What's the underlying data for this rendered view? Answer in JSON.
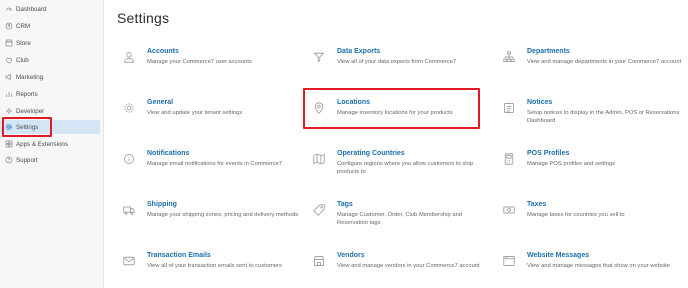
{
  "sidebar": {
    "items": [
      {
        "label": "Dashboard",
        "icon": "dashboard-icon"
      },
      {
        "label": "CRM",
        "icon": "crm-icon"
      },
      {
        "label": "Store",
        "icon": "store-icon"
      },
      {
        "label": "Club",
        "icon": "club-icon"
      },
      {
        "label": "Marketing",
        "icon": "marketing-icon"
      },
      {
        "label": "Reports",
        "icon": "reports-icon"
      },
      {
        "label": "Developer",
        "icon": "developer-icon"
      },
      {
        "label": "Settings",
        "icon": "settings-icon",
        "active": true
      },
      {
        "label": "Apps & Extensions",
        "icon": "apps-icon"
      },
      {
        "label": "Support",
        "icon": "support-icon"
      }
    ]
  },
  "main": {
    "title": "Settings",
    "tiles": [
      {
        "title": "Accounts",
        "desc": "Manage your Commerce7 user accounts",
        "icon": "user-icon"
      },
      {
        "title": "Data Exports",
        "desc": "View all of your data exports from Commerce7",
        "icon": "funnel-icon"
      },
      {
        "title": "Departments",
        "desc": "View and manage departments in your Commerce7 account",
        "icon": "sitemap-icon"
      },
      {
        "title": "General",
        "desc": "View and update your tenant settings",
        "icon": "gear-icon"
      },
      {
        "title": "Locations",
        "desc": "Manage inventory locations for your products",
        "icon": "map-pin-icon"
      },
      {
        "title": "Notices",
        "desc": "Setup notices to display in the Admin, POS or Reservations Dashboard",
        "icon": "notice-icon"
      },
      {
        "title": "Notifications",
        "desc": "Manage email notifications for events in Commerce7",
        "icon": "info-icon"
      },
      {
        "title": "Operating Countries",
        "desc": "Configure regions where you allow customers to ship products to",
        "icon": "map-icon"
      },
      {
        "title": "POS Profiles",
        "desc": "Manage POS profiles and settings",
        "icon": "pos-icon"
      },
      {
        "title": "Shipping",
        "desc": "Manage your shipping zones, pricing and delivery methods",
        "icon": "truck-icon"
      },
      {
        "title": "Tags",
        "desc": "Manage Customer, Order, Club Membership and Reservation tags",
        "icon": "tag-icon"
      },
      {
        "title": "Taxes",
        "desc": "Manage taxes for countries you sell to",
        "icon": "money-icon"
      },
      {
        "title": "Transaction Emails",
        "desc": "View all of your transaction emails sent to customers",
        "icon": "envelope-icon"
      },
      {
        "title": "Vendors",
        "desc": "View and manage vendors in your Commerce7 account",
        "icon": "vendor-icon"
      },
      {
        "title": "Website Messages",
        "desc": "View and manage messages that show on your website",
        "icon": "message-icon"
      }
    ]
  },
  "colors": {
    "accent": "#1b6fae",
    "highlight": "#e01b24",
    "active_bg": "#d4e6f6"
  }
}
